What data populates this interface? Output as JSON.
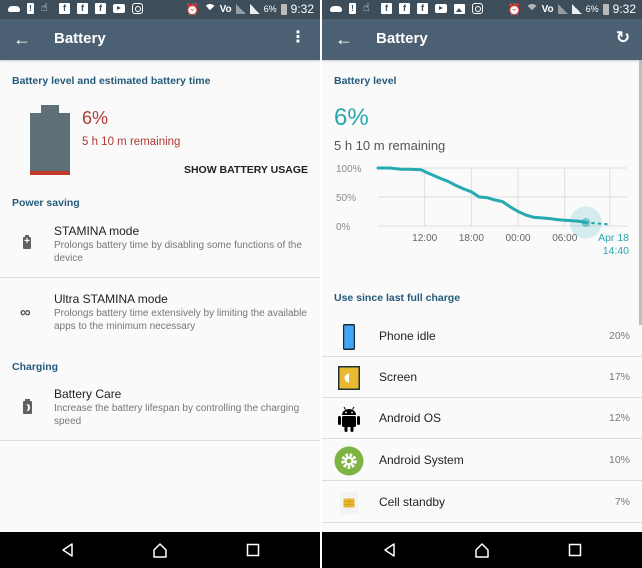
{
  "status_bar": {
    "time": "9:32",
    "battery_pct": "6%",
    "network_label": "Vo",
    "left_icons_left_screen": [
      "cloud-icon",
      "alert-icon",
      "hand-icon",
      "facebook-icon",
      "facebook-icon",
      "facebook-icon",
      "youtube-icon",
      "instagram-icon"
    ],
    "left_icons_right_screen": [
      "cloud-icon",
      "alert-icon",
      "hand-icon",
      "facebook-icon",
      "facebook-icon",
      "facebook-icon",
      "youtube-icon",
      "gallery-icon",
      "instagram-icon"
    ]
  },
  "left_screen": {
    "toolbar": {
      "title": "Battery",
      "back_icon": "arrow-back-icon",
      "menu_icon": "overflow-menu-icon"
    },
    "battery_section": {
      "label": "Battery level and estimated battery time",
      "level_pct": 6,
      "level_text": "6%",
      "remaining_text": "5 h  10 m remaining",
      "show_usage_label": "SHOW BATTERY USAGE"
    },
    "power_saving": {
      "label": "Power saving",
      "items": [
        {
          "icon": "battery-plus-icon",
          "title": "STAMINA mode",
          "description": "Prolongs battery time by disabling some functions of the device"
        },
        {
          "icon": "infinity-icon",
          "title": "Ultra STAMINA mode",
          "description": "Prolongs battery time extensively by limiting the available apps to the minimum necessary"
        }
      ]
    },
    "charging": {
      "label": "Charging",
      "items": [
        {
          "icon": "battery-care-icon",
          "title": "Battery Care",
          "description": "Increase the battery lifespan by controlling the charging speed"
        }
      ]
    }
  },
  "right_screen": {
    "toolbar": {
      "title": "Battery",
      "back_icon": "arrow-back-icon",
      "refresh_icon": "refresh-icon"
    },
    "battery_level": {
      "label": "Battery level",
      "level_text": "6%",
      "remaining_text": "5 h  10 m remaining"
    },
    "usage": {
      "label": "Use since last full charge",
      "items": [
        {
          "icon": "phone-idle-icon",
          "name": "Phone idle",
          "pct": "20%"
        },
        {
          "icon": "screen-brightness-icon",
          "name": "Screen",
          "pct": "17%"
        },
        {
          "icon": "android-icon",
          "name": "Android OS",
          "pct": "12%"
        },
        {
          "icon": "android-system-gear-icon",
          "name": "Android System",
          "pct": "10%"
        },
        {
          "icon": "sim-card-icon",
          "name": "Cell standby",
          "pct": "7%"
        }
      ]
    }
  },
  "chart_data": {
    "type": "line",
    "title": "",
    "xlabel": "",
    "ylabel": "",
    "y_ticks": [
      "100%",
      "50%",
      "0%"
    ],
    "ylim": [
      0,
      100
    ],
    "x_ticks": [
      "12:00",
      "18:00",
      "00:00",
      "06:00"
    ],
    "x_hours_range": [
      6,
      38
    ],
    "x_tick_hours": [
      12,
      18,
      24,
      30
    ],
    "current_marker_label": [
      "Apr 18",
      "14:40"
    ],
    "grid": true,
    "line_color": "#26aab2",
    "series": [
      {
        "name": "Battery level",
        "x_hours": [
          6.0,
          7.5,
          9.0,
          10.0,
          11.5,
          12.0,
          13.0,
          14.0,
          15.0,
          16.0,
          17.0,
          18.0,
          19.0,
          20.0,
          21.0,
          22.0,
          23.0,
          24.0,
          25.0,
          26.0,
          27.0,
          28.0,
          29.0,
          30.0,
          31.0,
          32.0,
          32.7
        ],
        "values": [
          100,
          100,
          98,
          98,
          97,
          94,
          88,
          82,
          77,
          70,
          64,
          59,
          50,
          49,
          45,
          42,
          33,
          25,
          19,
          15,
          14,
          13,
          11,
          10,
          9,
          8,
          6
        ]
      },
      {
        "name": "Projected",
        "style": "dotted",
        "x_hours": [
          32.7,
          35.5
        ],
        "values": [
          6,
          3
        ]
      }
    ]
  },
  "nav_bar": {
    "icons": [
      "nav-back-icon",
      "nav-home-icon",
      "nav-recents-icon"
    ]
  }
}
